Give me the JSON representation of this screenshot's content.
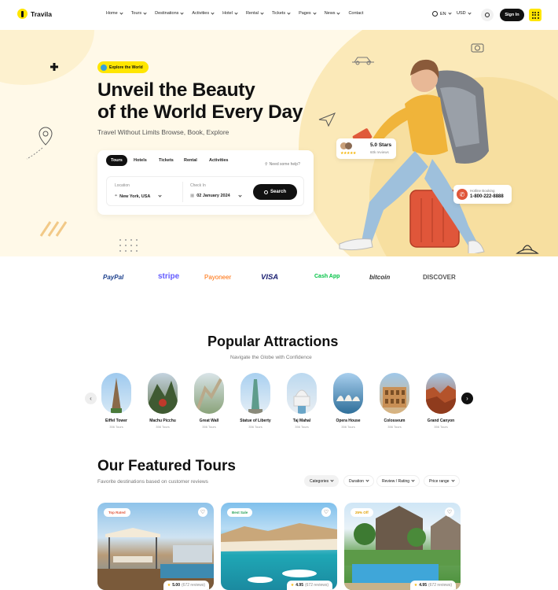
{
  "brand": {
    "name": "Travila"
  },
  "nav": {
    "items": [
      "Home",
      "Tours",
      "Destinations",
      "Activities",
      "Hotel",
      "Rental",
      "Tickets",
      "Pages",
      "News",
      "Contact"
    ],
    "language": "EN",
    "currency": "USD",
    "signin": "Sign In"
  },
  "hero": {
    "badge": "Explore the World",
    "title_line1": "Unveil the Beauty",
    "title_line2": "of the World Every Day",
    "subtitle": "Travel Without Limits Browse, Book, Explore",
    "search": {
      "tabs": [
        "Tours",
        "Hotels",
        "Tickets",
        "Rental",
        "Activities"
      ],
      "active_tab": "Tours",
      "help": "Need some help?",
      "location_label": "Location",
      "location_value": "New York, USA",
      "checkin_label": "Check In",
      "checkin_value": "02 January 2024",
      "button": "Search"
    },
    "rating_card": {
      "title": "5.0 Stars",
      "reviews": "60k reviews",
      "stars": 5
    },
    "hotline_card": {
      "label": "Hotline Booking",
      "number": "1-800-222-8888"
    }
  },
  "partners": [
    "PayPal",
    "stripe",
    "Payoneer",
    "VISA",
    "Cash App",
    "bitcoin",
    "DISCOVER"
  ],
  "attractions": {
    "title": "Popular Attractions",
    "subtitle": "Navigate the Globe with Confidence",
    "items": [
      {
        "name": "Eiffel Tower",
        "count": "356 Tours"
      },
      {
        "name": "Machu Picchu",
        "count": "356 Tours"
      },
      {
        "name": "Great Wall",
        "count": "356 Tours"
      },
      {
        "name": "Statue of Liberty",
        "count": "356 Tours"
      },
      {
        "name": "Taj Mahal",
        "count": "356 Tours"
      },
      {
        "name": "Opera House",
        "count": "356 Tours"
      },
      {
        "name": "Colosseum",
        "count": "356 Tours"
      },
      {
        "name": "Grand Canyon",
        "count": "356 Tours"
      }
    ]
  },
  "featured": {
    "title": "Our Featured Tours",
    "subtitle": "Favorite destinations based on customer reviews",
    "filters": [
      "Categories",
      "Duration",
      "Review / Rating",
      "Price range"
    ],
    "cards": [
      {
        "tag": "Top Rated",
        "rating": "5.00",
        "reviews": "(672 reviews)"
      },
      {
        "tag": "Best Sale",
        "rating": "4.95",
        "reviews": "(672 reviews)"
      },
      {
        "tag": "25% Off",
        "rating": "4.95",
        "reviews": "(672 reviews)"
      }
    ]
  },
  "colors": {
    "accent": "#FFE600",
    "dark": "#111111",
    "hero_bg": "#FFF9E8",
    "blob": "#F7DFA0"
  }
}
